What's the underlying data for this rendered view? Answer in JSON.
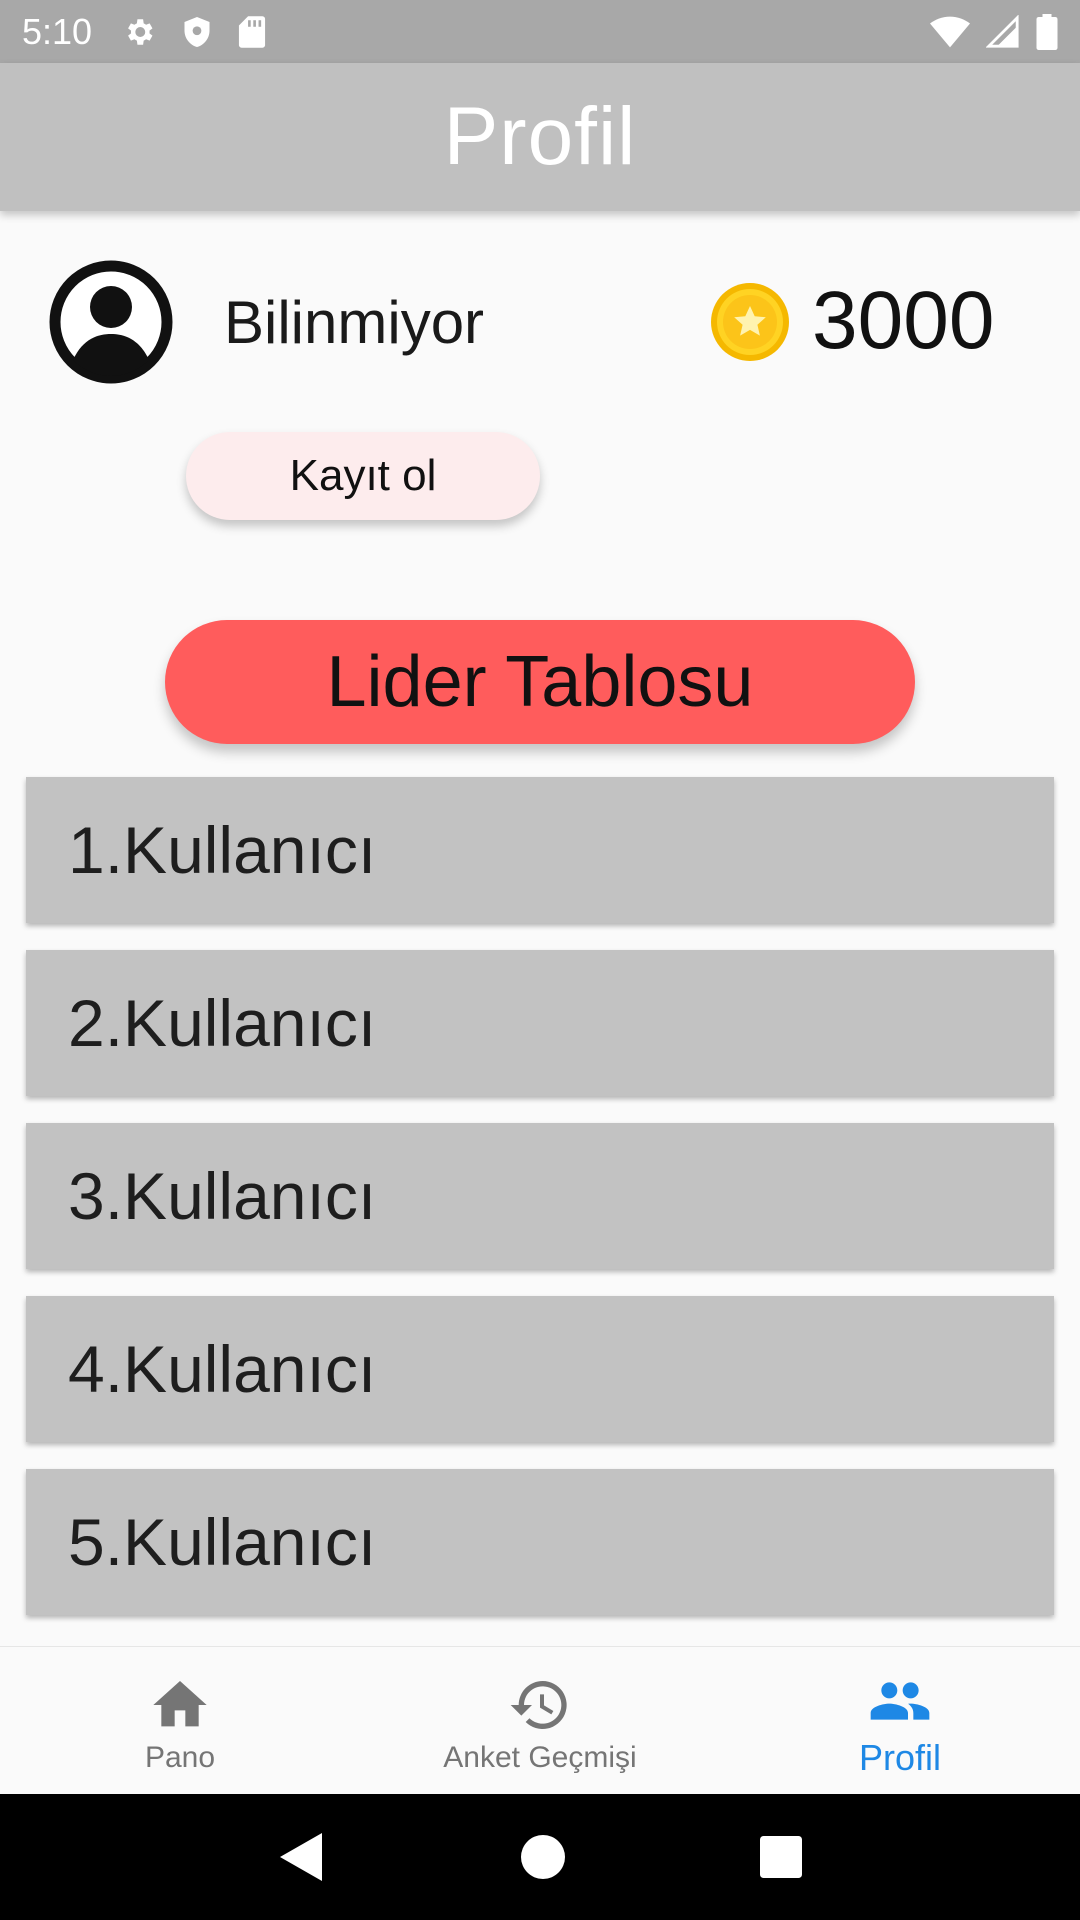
{
  "status_bar": {
    "time": "5:10",
    "left_icons": [
      "gear-icon",
      "shield-icon",
      "sd-card-icon"
    ],
    "right_icons": [
      "wifi-icon",
      "signal-icon",
      "battery-icon"
    ]
  },
  "app_bar": {
    "title": "Profil"
  },
  "profile": {
    "username": "Bilinmiyor",
    "coin_value": "3000",
    "register_label": "Kayıt ol"
  },
  "leaderboard": {
    "button_label": "Lider Tablosu",
    "rows": [
      {
        "label": "1.Kullanıcı"
      },
      {
        "label": "2.Kullanıcı"
      },
      {
        "label": "3.Kullanıcı"
      },
      {
        "label": "4.Kullanıcı"
      },
      {
        "label": "5.Kullanıcı"
      }
    ]
  },
  "bottom_nav": {
    "items": [
      {
        "label": "Pano",
        "icon": "home-icon",
        "active": false
      },
      {
        "label": "Anket Geçmişi",
        "icon": "history-icon",
        "active": false
      },
      {
        "label": "Profil",
        "icon": "people-icon",
        "active": true
      }
    ]
  },
  "colors": {
    "status_bar": "#a8a8a8",
    "app_bar": "#c0c0c0",
    "leaderboard_button": "#ff5c5c",
    "register_button": "#fdeced",
    "list_row": "#c2c2c2",
    "nav_active": "#1e88e5",
    "nav_inactive": "#757575"
  }
}
